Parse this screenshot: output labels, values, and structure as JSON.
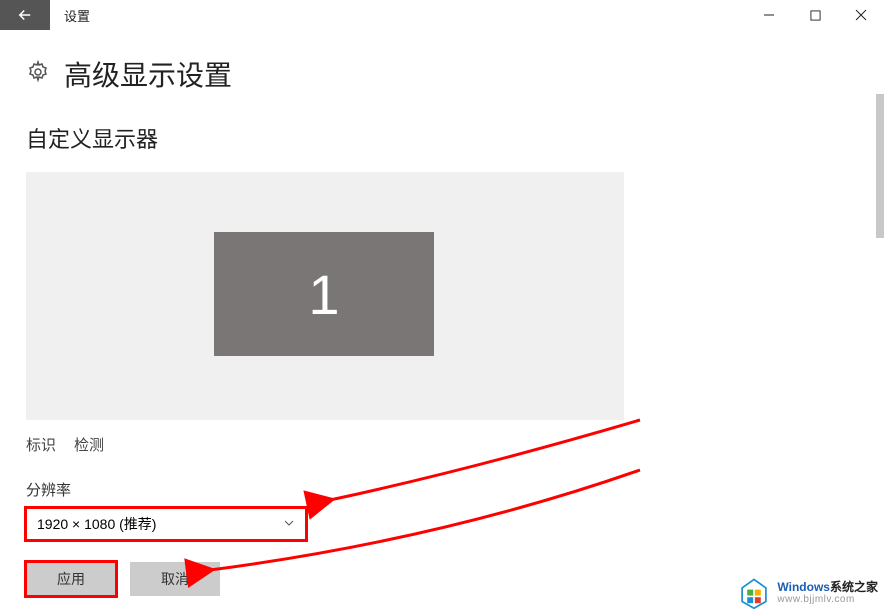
{
  "titlebar": {
    "app_label": "设置"
  },
  "page": {
    "title": "高级显示设置"
  },
  "section": {
    "customize_title": "自定义显示器"
  },
  "monitor": {
    "number": "1"
  },
  "links": {
    "identify": "标识",
    "detect": "检测"
  },
  "resolution": {
    "label": "分辨率",
    "selected": "1920 × 1080 (推荐)"
  },
  "buttons": {
    "apply": "应用",
    "cancel": "取消"
  },
  "watermark": {
    "line1a": "Windows",
    "line1b": "系统之家",
    "line2": "www.bjjmlv.com"
  }
}
